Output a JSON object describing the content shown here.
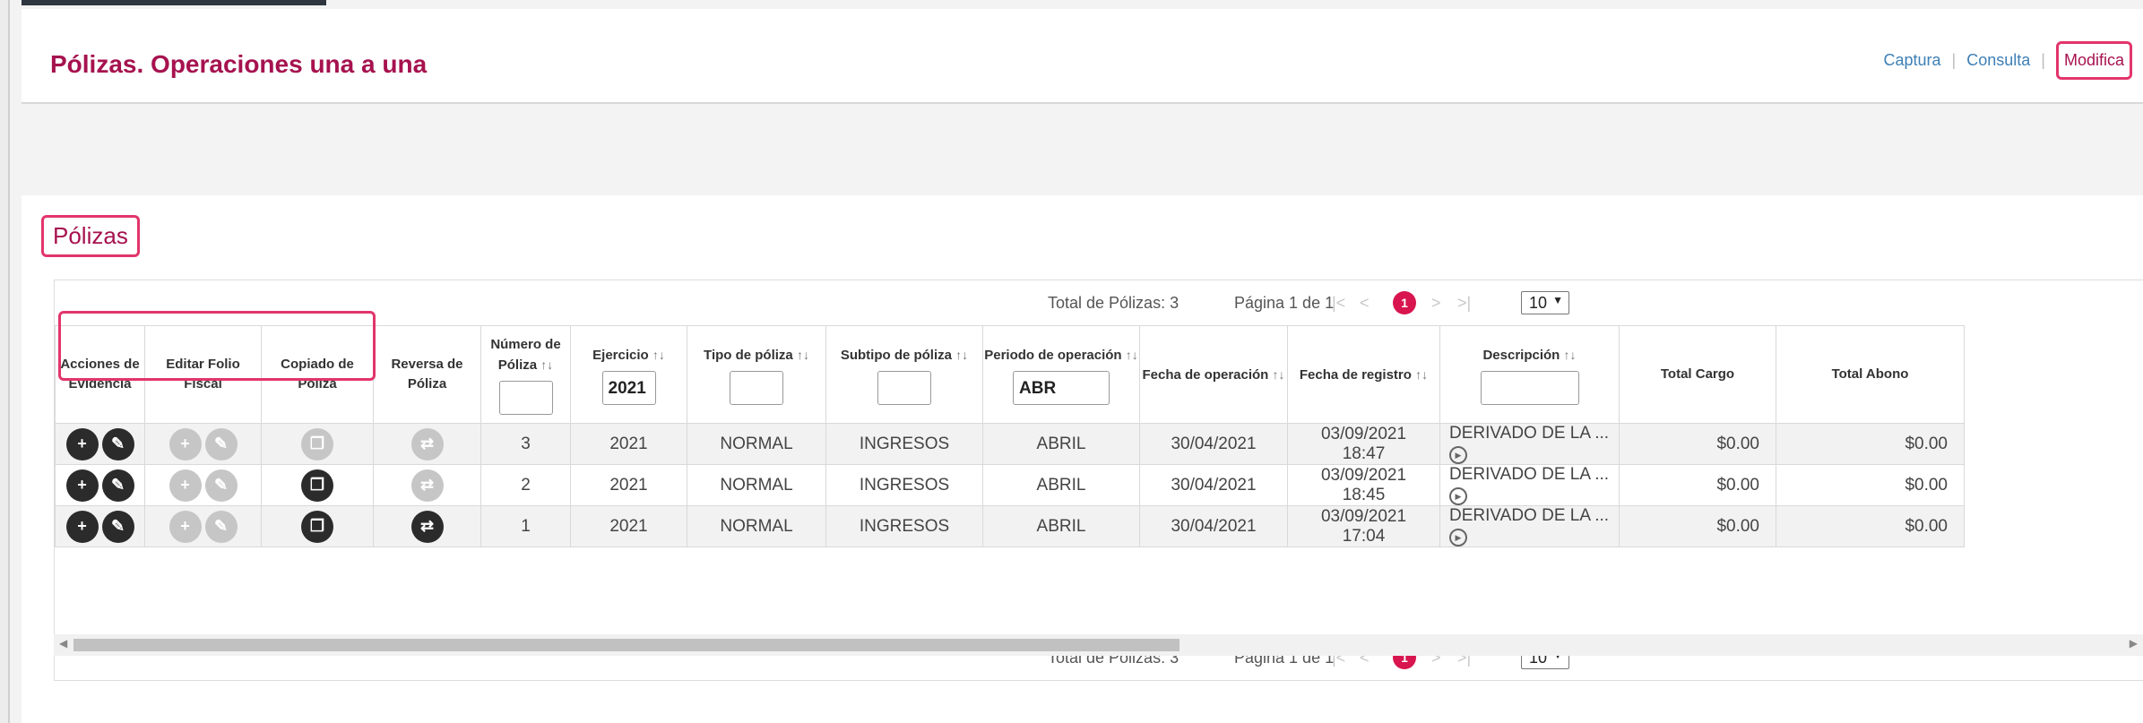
{
  "header": {
    "title": "Pólizas. Operaciones una a una",
    "nav": [
      "Captura",
      "Consulta",
      "Modifica"
    ]
  },
  "section": {
    "title": "Pólizas"
  },
  "pager": {
    "total": "Total de Pólizas: 3",
    "page_info": "Página 1 de 1",
    "first": "|<",
    "prev": "<",
    "current": "1",
    "next": ">",
    "last": ">|",
    "page_size": "10"
  },
  "table": {
    "headers": [
      "Acciones de Evidencia",
      "Editar Folio Fiscal",
      "Copiado de Póliza",
      "Reversa de Póliza",
      "Número de Póliza",
      "Ejercicio",
      "Tipo de póliza",
      "Subtipo de póliza",
      "Periodo de operación",
      "Fecha de operación",
      "Fecha de registro",
      "Descripción",
      "Total Cargo",
      "Total Abono"
    ],
    "filters": {
      "ejercicio": "2021",
      "periodo": "ABR"
    },
    "rows": [
      {
        "numero": "3",
        "ejercicio": "2021",
        "tipo": "NORMAL",
        "subtipo": "INGRESOS",
        "periodo": "ABRIL",
        "fecha_op": "30/04/2021",
        "fecha_reg_date": "03/09/2021",
        "fecha_reg_time": "18:47",
        "descripcion": "DERIVADO DE LA ...",
        "cargo": "$0.00",
        "abono": "$0.00",
        "copy_enabled": false,
        "reverse_enabled": false
      },
      {
        "numero": "2",
        "ejercicio": "2021",
        "tipo": "NORMAL",
        "subtipo": "INGRESOS",
        "periodo": "ABRIL",
        "fecha_op": "30/04/2021",
        "fecha_reg_date": "03/09/2021",
        "fecha_reg_time": "18:45",
        "descripcion": "DERIVADO DE LA ...",
        "cargo": "$0.00",
        "abono": "$0.00",
        "copy_enabled": true,
        "reverse_enabled": false
      },
      {
        "numero": "1",
        "ejercicio": "2021",
        "tipo": "NORMAL",
        "subtipo": "INGRESOS",
        "periodo": "ABRIL",
        "fecha_op": "30/04/2021",
        "fecha_reg_date": "03/09/2021",
        "fecha_reg_time": "17:04",
        "descripcion": "DERIVADO DE LA ...",
        "cargo": "$0.00",
        "abono": "$0.00",
        "copy_enabled": true,
        "reverse_enabled": true
      }
    ]
  },
  "colors": {
    "accent": "#a6124f",
    "highlight": "#e2356b",
    "link": "#3d7fb6",
    "current_page": "#d8154e"
  },
  "icons": {
    "evidence_add": "add-document-icon",
    "evidence_edit": "pencil-icon",
    "copy": "copy-icon",
    "reverse": "reverse-icon",
    "expand": "play-circle-icon"
  }
}
